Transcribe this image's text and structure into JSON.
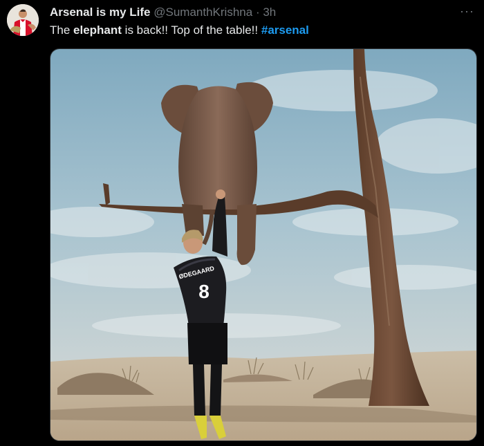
{
  "tweet": {
    "display_name": "Arsenal is my Life",
    "handle": "@SumanthKrishna",
    "separator": "·",
    "time": "3h",
    "more_label": "···",
    "text_before": "The ",
    "text_bold": "elephant",
    "text_middle": " is back!! Top of the table!! ",
    "hashtag": "#arsenal"
  },
  "media": {
    "jersey_name": "ØDEGAARD",
    "jersey_number": "8"
  },
  "colors": {
    "background": "#000000",
    "text": "#e7e9ea",
    "secondary": "#71767b",
    "link": "#1d9bf0"
  }
}
